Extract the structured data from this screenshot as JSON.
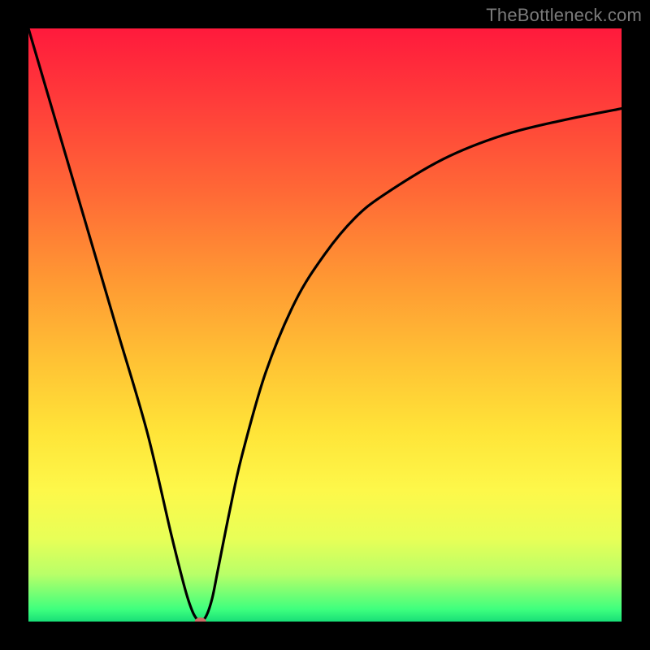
{
  "watermark": "TheBottleneck.com",
  "chart_data": {
    "type": "line",
    "title": "",
    "xlabel": "",
    "ylabel": "",
    "xlim": [
      0,
      100
    ],
    "ylim": [
      0,
      100
    ],
    "grid": false,
    "series": [
      {
        "name": "curve",
        "x": [
          0,
          5,
          10,
          15,
          20,
          24,
          26,
          27,
          28,
          29,
          30,
          31,
          32,
          34,
          36,
          40,
          45,
          50,
          55,
          60,
          70,
          80,
          90,
          100
        ],
        "values": [
          100,
          83,
          66,
          49,
          32,
          15,
          7,
          3.5,
          1,
          0,
          1,
          4,
          9,
          19,
          28,
          42,
          54,
          62,
          68,
          72,
          78,
          82,
          84.5,
          86.5
        ]
      }
    ],
    "marker": {
      "x": 29,
      "y": 0
    },
    "gradient_stops": [
      {
        "pos": 0,
        "color": "#ff1a3c"
      },
      {
        "pos": 50,
        "color": "#ffc234"
      },
      {
        "pos": 78,
        "color": "#fdf84a"
      },
      {
        "pos": 100,
        "color": "#18de77"
      }
    ]
  }
}
